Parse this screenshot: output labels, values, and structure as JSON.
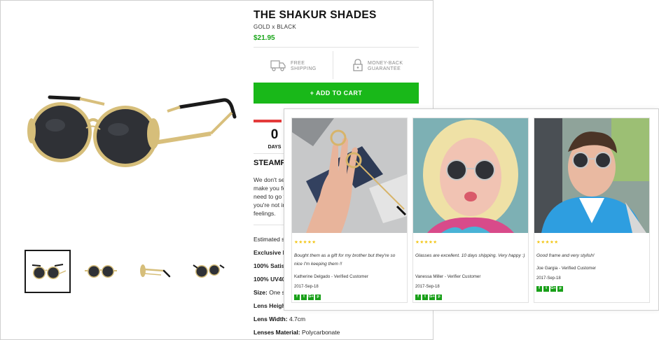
{
  "product": {
    "title": "THE SHAKUR SHADES",
    "variant": "GOLD x BLACK",
    "price": "$21.95"
  },
  "badges": [
    {
      "line1": "FREE",
      "line2": "SHIPPING",
      "icon": "truck-icon"
    },
    {
      "line1": "MONEY-BACK",
      "line2": "GUARANTEE",
      "icon": "padlock-icon"
    }
  ],
  "cart_button_label": "+ ADD TO CART",
  "countdown": {
    "value": "0",
    "unit": "DAYS"
  },
  "description": {
    "heading": "STEAMP",
    "lines": [
      "We don't se",
      "make you fe",
      "need to go t",
      "you're not ir",
      "feelings."
    ]
  },
  "specs": {
    "estimated": "Estimated s",
    "exclusive": "Exclusive P",
    "satisfaction": "100% Satisf",
    "uv": "100% UV40",
    "size_label": "Size:",
    "size_value": "One si",
    "lens_height": "Lens Heigh",
    "lens_width_label": "Lens Width:",
    "lens_width_value": "4.7cm",
    "material_label": "Lenses Material:",
    "material_value": "Polycarbonate"
  },
  "reviews": [
    {
      "stars": "★★★★★",
      "text": "Bought them as a gift for my brother but they're so nice I'm keeping them !!",
      "author": "Katherine Delgado - Verified Customer",
      "date": "2017-Sep-18"
    },
    {
      "stars": "★★★★★",
      "text": "Glasses are excellent. 10 days shipping. Very happy :)",
      "author": "Vanessa Miller - Verifier Customer",
      "date": "2017-Sep-18"
    },
    {
      "stars": "★★★★★",
      "text": "Good frame and very stylish!",
      "author": "Joe Gargia - Verified Customer",
      "date": "2017-Sep-18"
    }
  ],
  "share_icons": [
    "f",
    "t",
    "G+",
    "p"
  ],
  "colors": {
    "green": "#19b819",
    "price_green": "#1aa51a",
    "countdown_red": "#e33b3b",
    "star_yellow": "#f2c40f"
  }
}
